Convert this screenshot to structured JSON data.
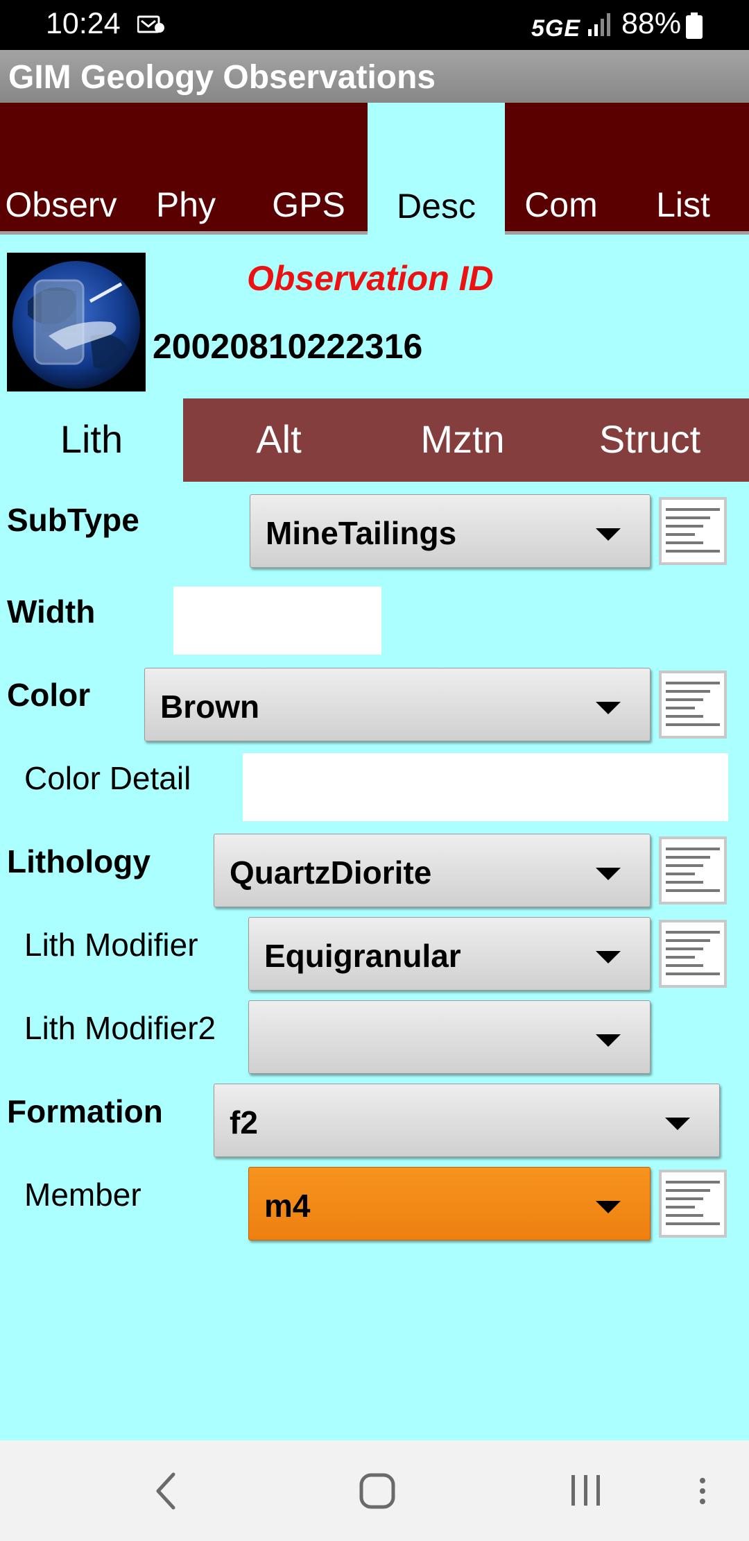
{
  "status_bar": {
    "time": "10:24",
    "network": "5GE",
    "battery": "88%",
    "icons": [
      "notification-icon",
      "signal-icon",
      "battery-icon"
    ]
  },
  "app": {
    "title": "GIM Geology Observations"
  },
  "top_tabs": [
    {
      "label": "Observ"
    },
    {
      "label": "Phy"
    },
    {
      "label": "GPS"
    },
    {
      "label": "Desc"
    },
    {
      "label": "Com"
    },
    {
      "label": "List"
    }
  ],
  "active_top_tab": "Desc",
  "header": {
    "id_label": "Observation ID",
    "id_value": "20020810222316"
  },
  "sub_tabs": [
    {
      "label": "Lith"
    },
    {
      "label": "Alt"
    },
    {
      "label": "Mztn"
    },
    {
      "label": "Struct"
    }
  ],
  "active_sub_tab": "Lith",
  "form": {
    "subtype": {
      "label": "SubType",
      "value": "MineTailings"
    },
    "width": {
      "label": "Width",
      "value": ""
    },
    "color": {
      "label": "Color",
      "value": "Brown"
    },
    "color_detail": {
      "label": "Color Detail",
      "value": ""
    },
    "lithology": {
      "label": "Lithology",
      "value": "QuartzDiorite"
    },
    "lith_modifier": {
      "label": "Lith Modifier",
      "value": "Equigranular"
    },
    "lith_modifier2": {
      "label": "Lith Modifier2",
      "value": ""
    },
    "formation": {
      "label": "Formation",
      "value": "f2"
    },
    "member": {
      "label": "Member",
      "value": "m4"
    }
  },
  "colors": {
    "background": "#abfffe",
    "top_tabs": "#5a0000",
    "sub_tabs": "#853e3e",
    "id_label": "#ee1111",
    "highlight_dropdown": "#f7941e"
  }
}
